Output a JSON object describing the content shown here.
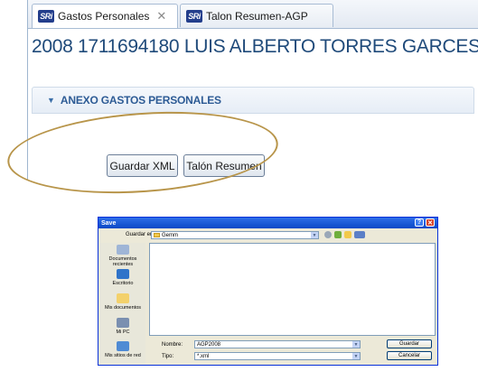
{
  "editor": {
    "tabs": [
      {
        "icon": "SRi",
        "label": "Gastos Personales",
        "close": "✕"
      },
      {
        "icon": "SRi",
        "label": "Talon Resumen-AGP"
      }
    ],
    "title": "2008 1711694180 LUIS ALBERTO TORRES GARCES",
    "section": {
      "label": "ANEXO GASTOS PERSONALES",
      "twisty": "▼"
    },
    "buttons": {
      "guardar_xml": "Guardar XML",
      "talon_resumen": "Talón Resumen"
    },
    "highlight_color": "#b8954a"
  },
  "dialog": {
    "title": "Save",
    "help": "?",
    "close": "✕",
    "look_in": {
      "label": "Guardar en:",
      "value": "Gemm"
    },
    "places": [
      {
        "label": "Documentos recientes",
        "icon": "recent-documents-icon"
      },
      {
        "label": "Escritorio",
        "icon": "desktop-icon"
      },
      {
        "label": "Mis documentos",
        "icon": "my-documents-icon"
      },
      {
        "label": "Mi PC",
        "icon": "my-computer-icon"
      },
      {
        "label": "Mis sitios de red",
        "icon": "network-places-icon"
      }
    ],
    "filename": {
      "label": "Nombre:",
      "value": "AGP2008"
    },
    "filetype": {
      "label": "Tipo:",
      "value": "*.xml"
    },
    "save_button": "Guardar",
    "cancel_button": "Cancelar"
  }
}
